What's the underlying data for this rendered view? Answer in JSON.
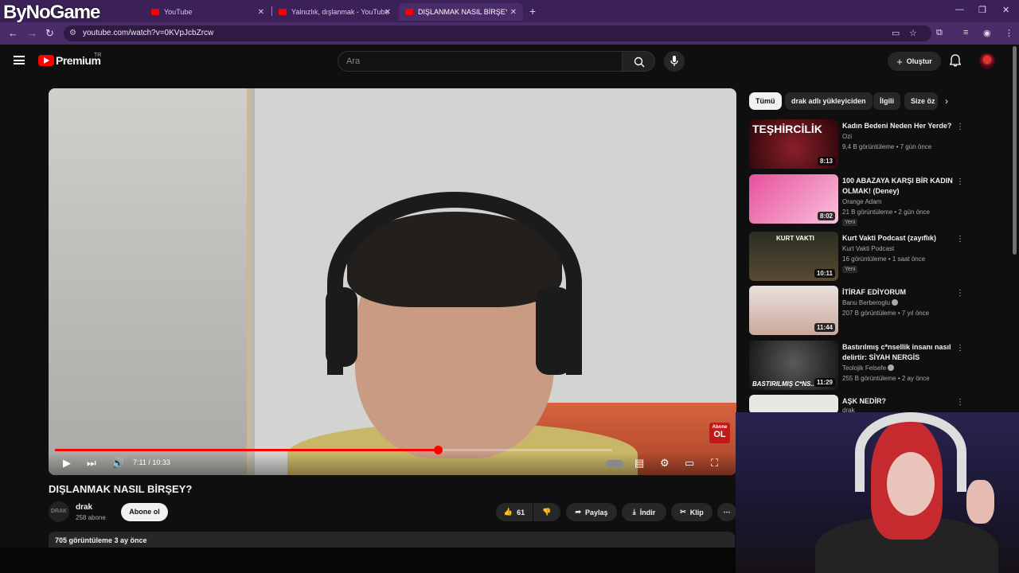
{
  "overlay_logo": "ByNoGame",
  "browser": {
    "tabs": [
      {
        "label": "YouTube"
      },
      {
        "label": "Yalnızlık, dışlanmak - YouTube"
      },
      {
        "label": "DIŞLANMAK NASIL BİRŞEY? - Y"
      }
    ],
    "url": "youtube.com/watch?v=0KVpJcbZrcw"
  },
  "header": {
    "brand": "Premium",
    "region": "TR",
    "search_placeholder": "Ara",
    "create_label": "Oluştur"
  },
  "player": {
    "progress": 0.687,
    "time": "7:11 / 10:33",
    "badge_top": "Abone",
    "badge_bottom": "OL"
  },
  "video": {
    "title": "DIŞLANMAK NASIL BİRŞEY?",
    "channel_avatar": "DRAK",
    "channel": "drak",
    "subscribers": "258 abone",
    "subscribe_label": "Abone ol",
    "likes": "61",
    "share_label": "Paylaş",
    "download_label": "İndir",
    "clip_label": "Klip",
    "views_date": "705 görüntüleme  3 ay önce"
  },
  "sidebar": {
    "chips": [
      "Tümü",
      "drak adlı yükleyiciden",
      "İlgili",
      "Size öz"
    ],
    "recommendations": [
      {
        "title": "Kadın Bedeni Neden Her Yerde?",
        "channel": "Ozi",
        "meta": "9,4 B görüntüleme • 7 gün önce",
        "duration": "8:13",
        "thumb_text": "TEŞHİRCİLİK",
        "new": ""
      },
      {
        "title": "100 ABAZAYA KARŞI BİR KADIN OLMAK! (Deney)",
        "channel": "Orange Adam",
        "meta": "21 B görüntüleme • 2 gün önce",
        "duration": "8:02",
        "thumb_text": "",
        "new": "Yeni"
      },
      {
        "title": "Kurt Vakti Podcast  (zayıflık)",
        "channel": "Kurt Vakti Podcast",
        "meta": "16 görüntüleme • 1 saat önce",
        "duration": "10:11",
        "thumb_text": "KURT VAKTI",
        "new": "Yeni"
      },
      {
        "title": "İTİRAF EDİYORUM",
        "channel": "Banu Berberoglu",
        "meta": "207 B görüntüleme • 7 yıl önce",
        "duration": "11:44",
        "thumb_text": "",
        "new": ""
      },
      {
        "title": "Bastırılmış c*nsellik insanı nasıl delirtir: SİYAH NERGİS",
        "channel": "Teolojik Felsefe",
        "meta": "255 B görüntüleme • 2 ay önce",
        "duration": "11:29",
        "thumb_text": "BASTIRILMIŞ C*NS..",
        "new": ""
      },
      {
        "title": "AŞK NEDİR?",
        "channel": "drak",
        "meta": "",
        "duration": "",
        "thumb_text": "",
        "new": ""
      }
    ]
  }
}
